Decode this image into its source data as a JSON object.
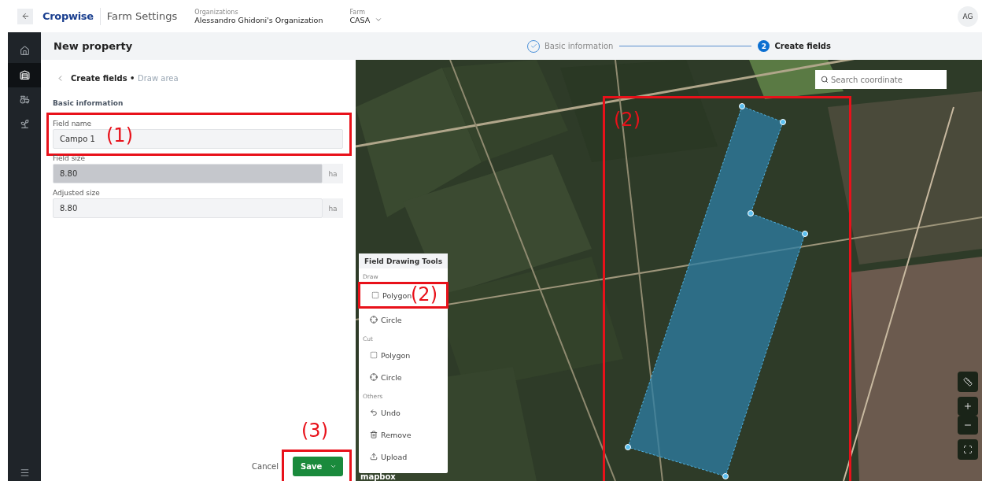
{
  "top_bar": {
    "brand": "Cropwise",
    "app_title": "Farm Settings",
    "organization": {
      "label": "Organizations",
      "value": "Alessandro Ghidoni's Organization"
    },
    "farm": {
      "label": "Farm",
      "value": "CASA"
    },
    "avatar": "AG"
  },
  "rail": {
    "items": [
      {
        "kind": "home",
        "selected": false
      },
      {
        "kind": "farm",
        "selected": true
      },
      {
        "kind": "tractor",
        "selected": false
      },
      {
        "kind": "seed",
        "selected": false
      }
    ]
  },
  "header": {
    "title": "New property",
    "steps": [
      {
        "label": "Basic information",
        "done": true,
        "selected": false
      },
      {
        "label": "Create fields",
        "number": "2",
        "done": false,
        "selected": true
      }
    ]
  },
  "form": {
    "breadcrumb": "Create fields",
    "breadcrumb_current": "Draw area",
    "breadcrumb_separator": "•",
    "section": "Basic information",
    "fields": [
      {
        "label": "Field name",
        "value": "Campo 1",
        "disabled": false,
        "annotation": "(1)"
      },
      {
        "label": "Field size",
        "value": "8.80",
        "unit": "ha",
        "disabled": true
      },
      {
        "label": "Adjusted size",
        "value": "8.80",
        "unit": "ha",
        "disabled": false
      }
    ],
    "cancel": "Cancel",
    "save": "Save",
    "save_annotation": "(3)"
  },
  "map": {
    "search": {
      "placeholder": "Search coordinate"
    },
    "annotation": "(2)",
    "attribution": "mapbox",
    "tools": {
      "title": "Field Drawing Tools",
      "groups": [
        {
          "label": "Draw",
          "items": [
            {
              "kind": "polygon",
              "label": "Polygon",
              "annotation": "(2)"
            },
            {
              "kind": "circle",
              "label": "Circle"
            }
          ]
        },
        {
          "label": "Cut",
          "items": [
            {
              "kind": "polygon",
              "label": "Polygon"
            },
            {
              "kind": "circle",
              "label": "Circle"
            }
          ]
        },
        {
          "label": "Others",
          "items": [
            {
              "kind": "undo",
              "label": "Undo"
            },
            {
              "kind": "remove",
              "label": "Remove"
            },
            {
              "kind": "upload",
              "label": "Upload"
            }
          ]
        }
      ]
    }
  }
}
